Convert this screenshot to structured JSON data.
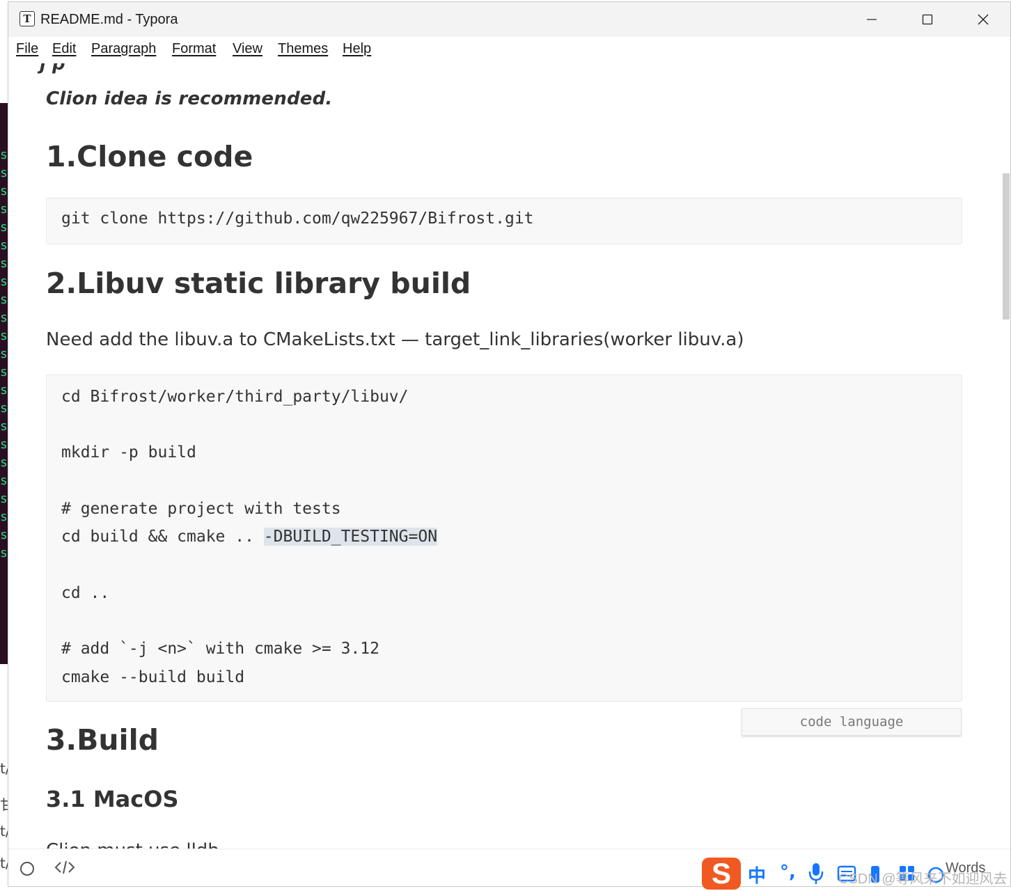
{
  "window": {
    "title": "README.md - Typora",
    "app_icon_letter": "T"
  },
  "menu": [
    "File",
    "Edit",
    "Paragraph",
    "Format",
    "View",
    "Themes",
    "Help"
  ],
  "document": {
    "clipped_top_text": "j   p",
    "recommendation": "Clion idea is recommended.",
    "h_clone": "1.Clone code",
    "clone_code": "git clone https://github.com/qw225967/Bifrost.git",
    "h_libuv": "2.Libuv static library build",
    "libuv_note": "Need add the libuv.a to CMakeLists.txt — target_link_libraries(worker libuv.a)",
    "libuv_code": {
      "line1": "cd Bifrost/worker/third_party/libuv/",
      "line2": "mkdir -p build",
      "line3": "# generate project with tests",
      "line4_pre": "cd build && cmake .. ",
      "line4_sel": "-DBUILD_TESTING=ON",
      "line5": "cd ..",
      "line6": "# add `-j <n>` with cmake >= 3.12",
      "line7": "cmake --build build"
    },
    "code_language_placeholder": "code language",
    "h_build": "3.Build",
    "h_macos": "3.1 MacOS",
    "clipped_bottom_text": "Clion must use lldb"
  },
  "statusbar": {
    "words": "Words"
  },
  "ime": {
    "logo": "S",
    "mode": "中",
    "punct": "°,",
    "watermark": "CSDN @等风来不如迎风去"
  },
  "background": {
    "terminal_glyph": "s",
    "side_chars": [
      "t/",
      "甘",
      "t/",
      "t/"
    ]
  }
}
